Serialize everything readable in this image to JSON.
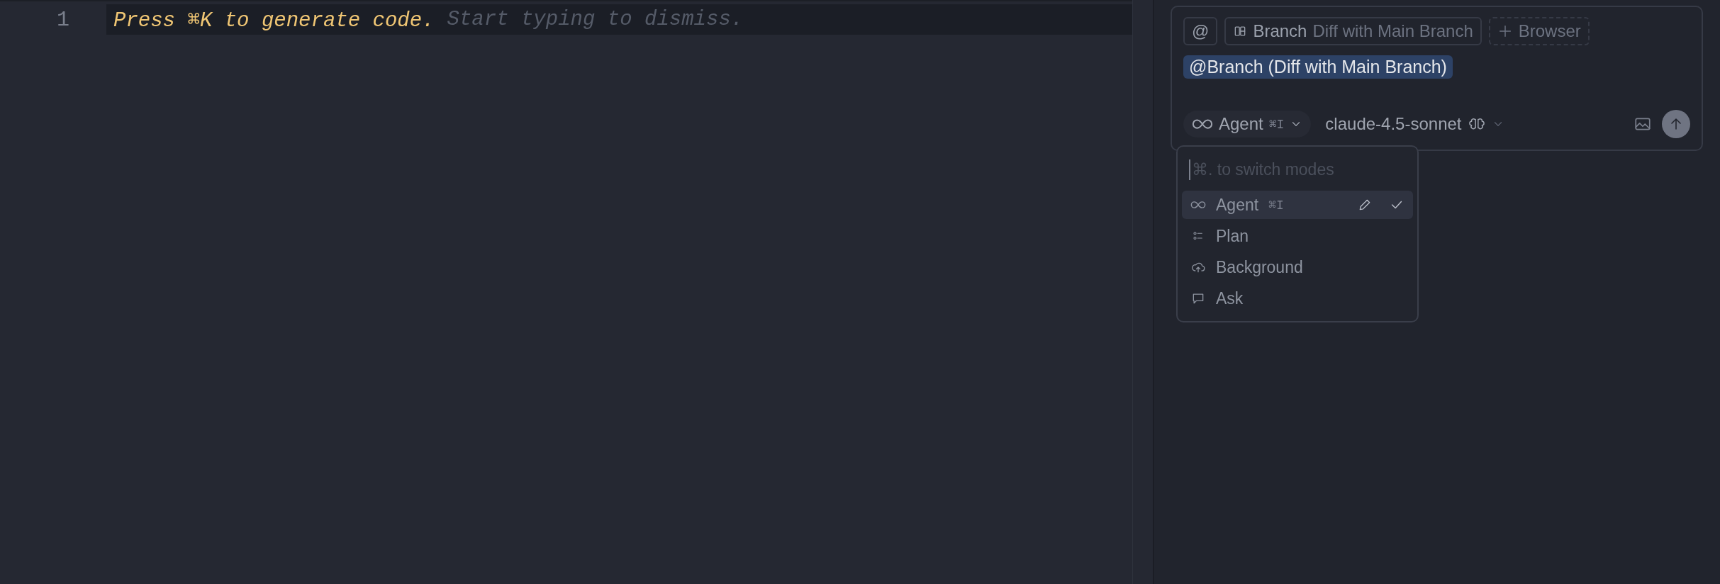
{
  "editor": {
    "lines": [
      {
        "number": "1",
        "hint": "Press ⌘K to generate code.",
        "dismiss": "Start typing to dismiss."
      }
    ]
  },
  "chat": {
    "context_chips": [
      {
        "kind": "mention",
        "label": "@"
      },
      {
        "kind": "branch",
        "label": "Branch",
        "detail": "Diff with Main Branch"
      },
      {
        "kind": "add",
        "label": "Browser"
      }
    ],
    "input_text": "@Branch (Diff with Main Branch)",
    "mode_button": {
      "label": "Agent",
      "shortcut": "⌘I"
    },
    "model": "claude-4.5-sonnet"
  },
  "mode_menu": {
    "placeholder": "⌘. to switch modes",
    "items": [
      {
        "kind": "agent",
        "label": "Agent",
        "shortcut": "⌘I",
        "selected": true
      },
      {
        "kind": "plan",
        "label": "Plan",
        "selected": false
      },
      {
        "kind": "background",
        "label": "Background",
        "selected": false
      },
      {
        "kind": "ask",
        "label": "Ask",
        "selected": false
      }
    ]
  }
}
